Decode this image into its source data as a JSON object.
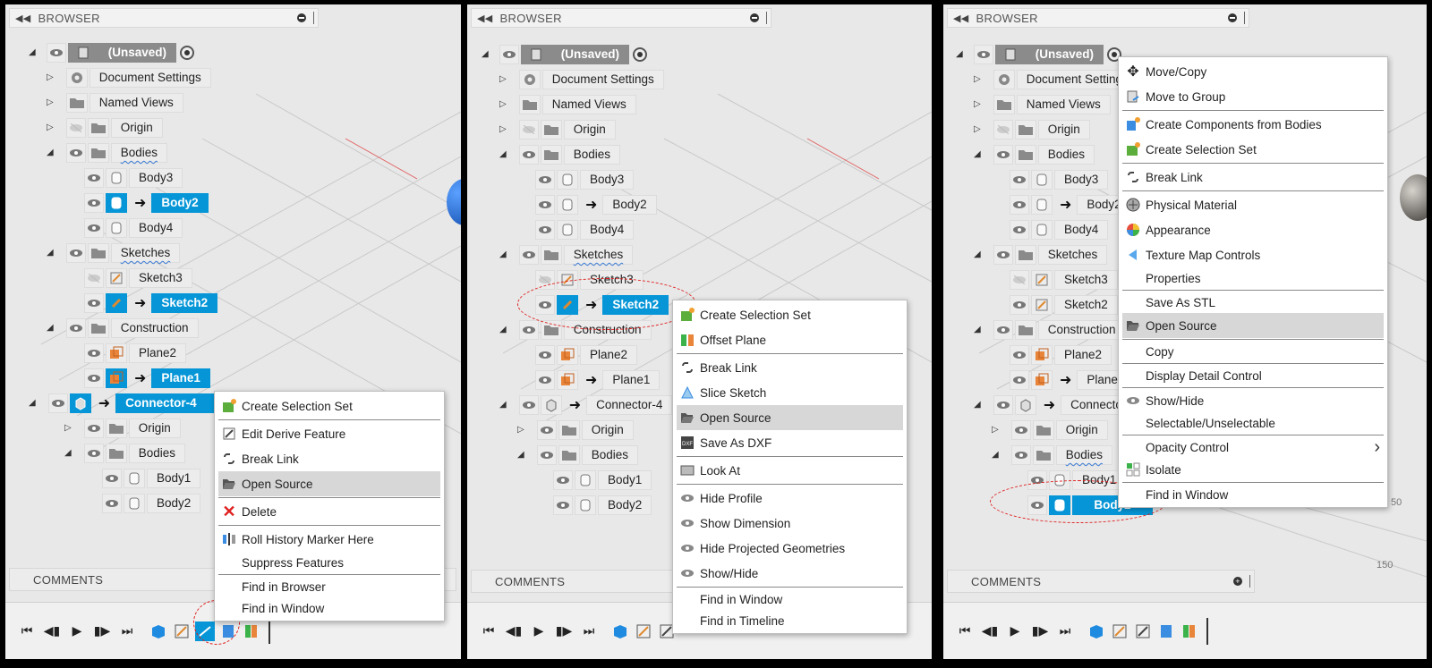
{
  "browser_title": "BROWSER",
  "comments_title": "COMMENTS",
  "root": "(Unsaved)",
  "doc_settings": "Document Settings",
  "named_views": "Named Views",
  "origin": "Origin",
  "bodies": "Bodies",
  "body3": "Body3",
  "body2": "Body2",
  "body4": "Body4",
  "body1": "Body1",
  "sketches": "Sketches",
  "sketch3": "Sketch3",
  "sketch2": "Sketch2",
  "construction": "Construction",
  "plane2": "Plane2",
  "plane1": "Plane1",
  "connector": "Connector-4",
  "menu1": [
    "Create Selection Set",
    "Edit Derive Feature",
    "Break Link",
    "Open Source",
    "Delete",
    "Roll History Marker Here",
    "Suppress Features",
    "Find in Browser",
    "Find in Window"
  ],
  "menu2": [
    "Create Selection Set",
    "Offset Plane",
    "Break Link",
    "Slice Sketch",
    "Open Source",
    "Save As DXF",
    "Look At",
    "Hide Profile",
    "Show Dimension",
    "Hide Projected Geometries",
    "Show/Hide",
    "Find in Window",
    "Find in Timeline"
  ],
  "menu3": [
    "Move/Copy",
    "Move to Group",
    "Create Components from Bodies",
    "Create Selection Set",
    "Break Link",
    "Physical Material",
    "Appearance",
    "Texture Map Controls",
    "Properties",
    "Save As STL",
    "Open Source",
    "Copy",
    "Display Detail Control",
    "Show/Hide",
    "Selectable/Unselectable",
    "Opacity Control",
    "Isolate",
    "Find in Window"
  ],
  "grid_labels": {
    "a": "50",
    "b": "150"
  },
  "colors": {
    "accent": "#0696d7",
    "highlight": "#d7d7d7",
    "dashed_circle": "#e02020"
  }
}
